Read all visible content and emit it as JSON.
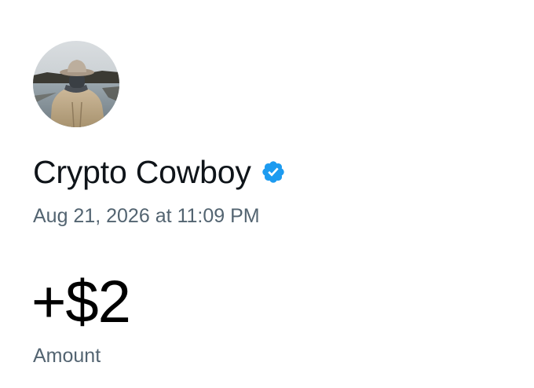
{
  "profile": {
    "avatar_icon": "profile-photo-cowboy",
    "display_name": "Crypto Cowboy",
    "verified_icon": "verified-badge-icon",
    "verified_color": "#1d9bf0"
  },
  "transaction": {
    "timestamp": "Aug 21, 2026 at 11:09 PM",
    "amount": "+$2",
    "amount_label": "Amount"
  },
  "colors": {
    "primary_text": "#0f1419",
    "secondary_text": "#536471",
    "background": "#ffffff"
  }
}
